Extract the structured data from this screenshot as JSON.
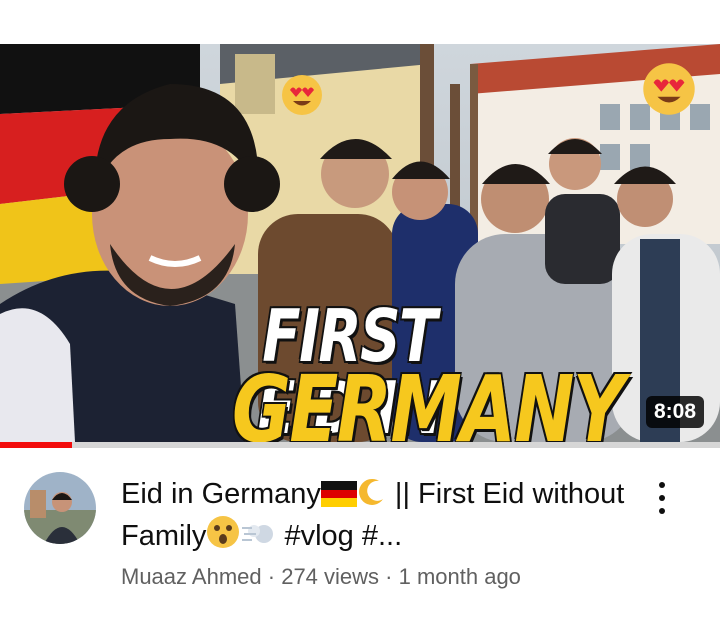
{
  "video": {
    "thumbnail_text_line1": "FIRST EID IN",
    "thumbnail_text_line2": "GERMANY",
    "duration": "8:08",
    "watch_progress_fraction": 0.1,
    "title": "Eid in Germany🇩🇪🌙 || First Eid without Family😮💨 #vlog #...",
    "title_part1": "Eid in Germany",
    "title_part2": " || First Eid without Family",
    "title_part3": " #vlog #...",
    "channel": "Muaaz Ahmed",
    "views": "274 views",
    "age": "1 month ago",
    "separator": " · "
  },
  "icons": {
    "flag": "german-flag-icon",
    "moon": "crescent-moon-icon",
    "surprise": "astonished-face-icon",
    "dash": "dash-icon",
    "heart_eyes": "heart-eyes-emoji-icon",
    "more": "more-vert-icon"
  },
  "colors": {
    "progress_accent": "#f20c0c",
    "overlay_yellow": "#f6c81e",
    "text_primary": "#0f0f0f",
    "text_secondary": "#606060"
  }
}
